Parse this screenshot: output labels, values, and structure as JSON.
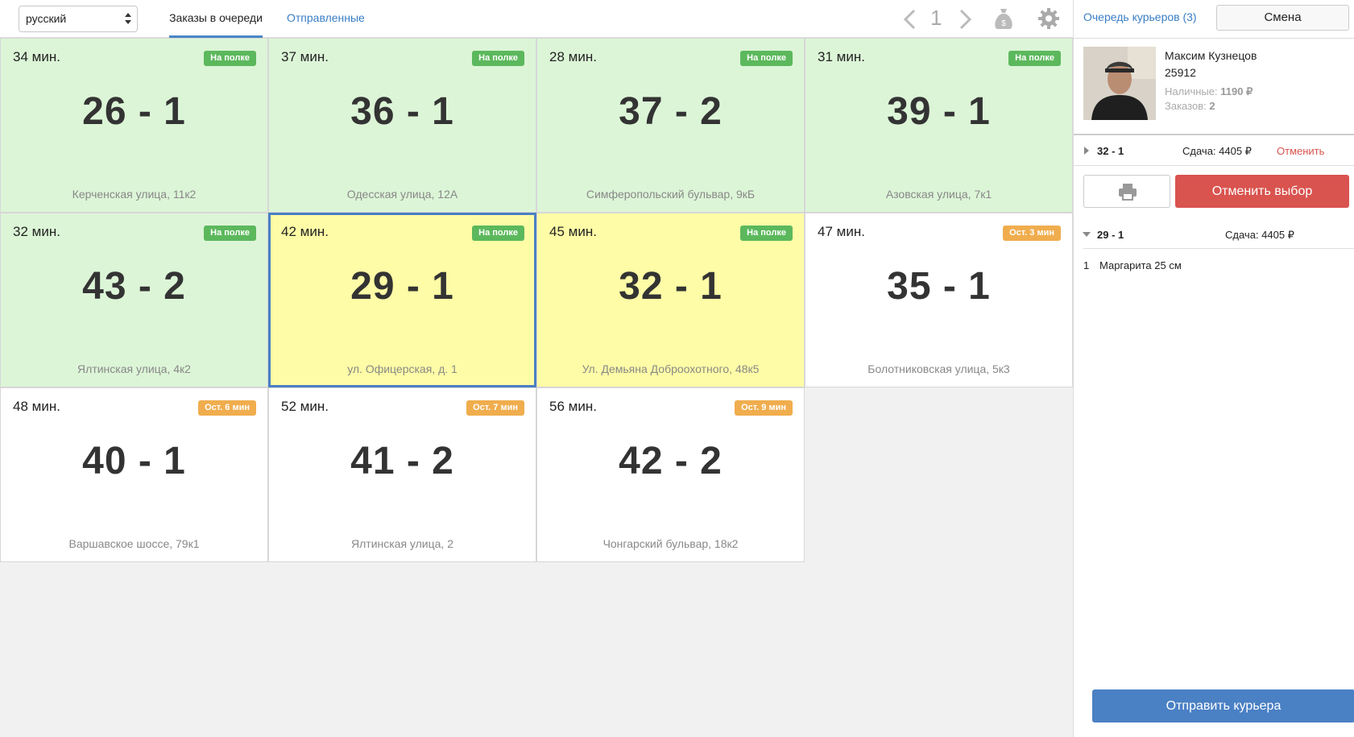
{
  "topbar": {
    "language": "русский",
    "tabs": {
      "queue": "Заказы в очереди",
      "sent": "Отправленные"
    },
    "page_number": "1"
  },
  "cards": [
    {
      "minutes": "34 мин.",
      "badge": "На полке",
      "badge_color": "#5cb85c",
      "number": "26 - 1",
      "address": "Керченская улица, 11к2",
      "bg": "green"
    },
    {
      "minutes": "37 мин.",
      "badge": "На полке",
      "badge_color": "#5cb85c",
      "number": "36 - 1",
      "address": "Одесская улица, 12А",
      "bg": "green"
    },
    {
      "minutes": "28 мин.",
      "badge": "На полке",
      "badge_color": "#5cb85c",
      "number": "37 - 2",
      "address": "Симферопольский бульвар, 9кБ",
      "bg": "green"
    },
    {
      "minutes": "31 мин.",
      "badge": "На полке",
      "badge_color": "#5cb85c",
      "number": "39 - 1",
      "address": "Азовская улица, 7к1",
      "bg": "green"
    },
    {
      "minutes": "32 мин.",
      "badge": "На полке",
      "badge_color": "#5cb85c",
      "number": "43 - 2",
      "address": "Ялтинская улица, 4к2",
      "bg": "green"
    },
    {
      "minutes": "42 мин.",
      "badge": "На полке",
      "badge_color": "#5cb85c",
      "number": "29 - 1",
      "address": "ул. Офицерская, д. 1",
      "bg": "yellow",
      "selected": true
    },
    {
      "minutes": "45 мин.",
      "badge": "На полке",
      "badge_color": "#5cb85c",
      "number": "32 - 1",
      "address": "Ул. Демьяна Доброохотного, 48к5",
      "bg": "yellow"
    },
    {
      "minutes": "47 мин.",
      "badge": "Ост. 3 мин",
      "badge_color": "#f0ad4e",
      "number": "35 - 1",
      "address": "Болотниковская улица, 5к3",
      "bg": "white"
    },
    {
      "minutes": "48 мин.",
      "badge": "Ост. 6 мин",
      "badge_color": "#f0ad4e",
      "number": "40 - 1",
      "address": "Варшавское шоссе, 79к1",
      "bg": "white"
    },
    {
      "minutes": "52 мин.",
      "badge": "Ост. 7 мин",
      "badge_color": "#f0ad4e",
      "number": "41 - 2",
      "address": "Ялтинская улица, 2",
      "bg": "white"
    },
    {
      "minutes": "56 мин.",
      "badge": "Ост. 9 мин",
      "badge_color": "#f0ad4e",
      "number": "42 - 2",
      "address": "Чонгарский бульвар, 18к2",
      "bg": "white"
    }
  ],
  "panel": {
    "queue_link": "Очередь курьеров (3)",
    "shift_button": "Смена",
    "courier": {
      "name": "Максим Кузнецов",
      "id": "25912",
      "cash_label": "Наличные:",
      "cash_value": "1190 ₽",
      "orders_label": "Заказов:",
      "orders_value": "2"
    },
    "orders": [
      {
        "id": "32 - 1",
        "change": "Сдача: 4405 ₽",
        "cancel": "Отменить"
      },
      {
        "id": "29 - 1",
        "change": "Сдача: 4405 ₽"
      }
    ],
    "cancel_selection_button": "Отменить выбор",
    "items": [
      {
        "qty": "1",
        "name": "Маргарита 25 см"
      }
    ],
    "send_button": "Отправить курьера"
  }
}
